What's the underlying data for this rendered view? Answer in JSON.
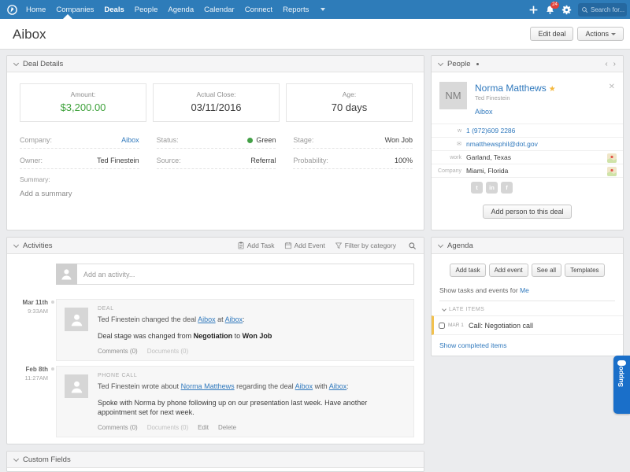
{
  "colors": {
    "nav_blue": "#2e7cb9",
    "link_blue": "#3079bd",
    "status_green": "#43a047",
    "amount_green": "#3fa23c",
    "badge_red": "#e2413a",
    "support_blue": "#1a6fc9",
    "late_item_bar": "#f2c14e",
    "star_gold": "#f5b83d"
  },
  "nav": {
    "items": [
      "Home",
      "Companies",
      "Deals",
      "People",
      "Agenda",
      "Calendar",
      "Connect",
      "Reports"
    ],
    "active_item": "Deals",
    "notification_count": "24",
    "search_placeholder": "Search for..."
  },
  "header": {
    "title": "Aibox",
    "edit_deal_button": "Edit deal",
    "actions_button": "Actions"
  },
  "deal_details": {
    "panel_title": "Deal Details",
    "stats": [
      {
        "label": "Amount:",
        "value": "$3,200.00"
      },
      {
        "label": "Actual Close:",
        "value": "03/11/2016"
      },
      {
        "label": "Age:",
        "value": "70 days"
      }
    ],
    "fields": [
      {
        "label": "Company:",
        "value": "Aibox"
      },
      {
        "label": "Status:",
        "value": "Green"
      },
      {
        "label": "Stage:",
        "value": "Won Job"
      },
      {
        "label": "Owner:",
        "value": "Ted Finestein"
      },
      {
        "label": "Source:",
        "value": "Referral"
      },
      {
        "label": "Probability:",
        "value": "100%"
      }
    ],
    "summary_label": "Summary:",
    "summary_placeholder": "Add a summary"
  },
  "people": {
    "panel_title": "People",
    "card": {
      "initials": "NM",
      "name": "Norma Matthews",
      "subtitle": "Ted Finestein",
      "company_link": "Aibox",
      "phone_label": "w",
      "phone": "1 (972)609 2286",
      "email": "nmatthewsphil@dot.gov",
      "address_label": "work",
      "address": "Garland, Texas",
      "company_label": "Company",
      "company_address": "Miami, Florida"
    },
    "add_person_button": "Add person to this deal"
  },
  "activities": {
    "panel_title": "Activities",
    "add_task_button": "Add Task",
    "add_event_button": "Add Event",
    "filter_button": "Filter by category",
    "composer_placeholder": "Add an activity...",
    "items": [
      {
        "date": "Mar 11th",
        "time": "9:33AM",
        "category": "DEAL",
        "title": [
          "Ted Finestein changed the deal ",
          "Aibox",
          " at ",
          "Aibox",
          ":"
        ],
        "body": [
          "Deal stage was changed from ",
          "Negotiation",
          " to ",
          "Won Job"
        ],
        "comments": "Comments (0)",
        "documents": "Documents (0)"
      },
      {
        "date": "Feb 8th",
        "time": "11:27AM",
        "category": "PHONE CALL",
        "title": [
          "Ted Finestein wrote about ",
          "Norma Matthews",
          " regarding the deal ",
          "Aibox",
          " with ",
          "Aibox",
          ":"
        ],
        "body": "Spoke with Norma by phone following up on our presentation last week. Have another appointment set for next week.",
        "comments": "Comments (0)",
        "documents": "Documents (0)",
        "edit": "Edit",
        "delete": "Delete"
      }
    ]
  },
  "agenda": {
    "panel_title": "Agenda",
    "buttons": [
      "Add task",
      "Add event",
      "See all",
      "Templates"
    ],
    "filter_prefix": "Show tasks and events for ",
    "filter_link": "Me",
    "late_section_label": "Late items",
    "items": [
      {
        "date": "MAR 1",
        "text": "Call: Negotiation call"
      }
    ],
    "show_completed_link": "Show completed items"
  },
  "custom_fields": {
    "panel_title": "Custom Fields"
  },
  "support_tab": {
    "label": "Support"
  }
}
